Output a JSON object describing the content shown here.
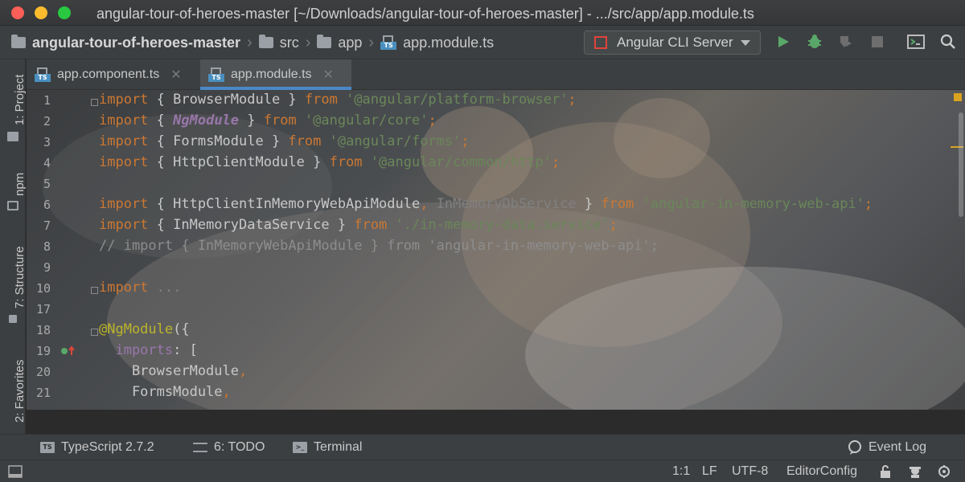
{
  "window": {
    "title": "angular-tour-of-heroes-master [~/Downloads/angular-tour-of-heroes-master] - .../src/app/app.module.ts"
  },
  "navbar": {
    "crumbs": [
      "angular-tour-of-heroes-master",
      "src",
      "app",
      "app.module.ts"
    ],
    "run_config": "Angular CLI Server",
    "icons": [
      "run-icon",
      "debug-icon",
      "coverage-icon",
      "stop-icon",
      "terminal-icon",
      "search-icon"
    ]
  },
  "left_tools": [
    "1: Project",
    "npm",
    "7: Structure",
    "2: Favorites"
  ],
  "tabs": [
    {
      "label": "app.component.ts",
      "active": false
    },
    {
      "label": "app.module.ts",
      "active": true
    }
  ],
  "editor": {
    "line_numbers": [
      "1",
      "2",
      "3",
      "4",
      "5",
      "6",
      "7",
      "8",
      "9",
      "10",
      "17",
      "18",
      "19",
      "20",
      "21"
    ],
    "lines": [
      [
        {
          "t": "import",
          "c": "kw"
        },
        {
          "t": " { BrowserModule } ",
          "c": "cls"
        },
        {
          "t": "from",
          "c": "kw"
        },
        {
          "t": " '@angular/platform-browser'",
          "c": "str"
        },
        {
          "t": ";",
          "c": "kw"
        }
      ],
      [
        {
          "t": "import",
          "c": "kw"
        },
        {
          "t": " { ",
          "c": "cls"
        },
        {
          "t": "NgModule",
          "c": "ital"
        },
        {
          "t": " } ",
          "c": "cls"
        },
        {
          "t": "from",
          "c": "kw"
        },
        {
          "t": " '@angular/core'",
          "c": "str"
        },
        {
          "t": ";",
          "c": "kw"
        }
      ],
      [
        {
          "t": "import",
          "c": "kw"
        },
        {
          "t": " { FormsModule } ",
          "c": "cls"
        },
        {
          "t": "from",
          "c": "kw"
        },
        {
          "t": " '@angular/forms'",
          "c": "str"
        },
        {
          "t": ";",
          "c": "kw"
        }
      ],
      [
        {
          "t": "import",
          "c": "kw"
        },
        {
          "t": " { HttpClientModule } ",
          "c": "cls"
        },
        {
          "t": "from",
          "c": "kw"
        },
        {
          "t": " '@angular/common/http'",
          "c": "str"
        },
        {
          "t": ";",
          "c": "kw"
        }
      ],
      [],
      [
        {
          "t": "import",
          "c": "kw"
        },
        {
          "t": " { HttpClientInMemoryWebApiModule",
          "c": "cls"
        },
        {
          "t": ",",
          "c": "kw"
        },
        {
          "t": " InMemoryDbService",
          "c": "dim"
        },
        {
          "t": " } ",
          "c": "cls"
        },
        {
          "t": "from",
          "c": "kw"
        },
        {
          "t": " 'angular-in-memory-web-api'",
          "c": "str"
        },
        {
          "t": ";",
          "c": "kw"
        }
      ],
      [
        {
          "t": "import",
          "c": "kw"
        },
        {
          "t": " { InMemoryDataService } ",
          "c": "cls"
        },
        {
          "t": "from",
          "c": "kw"
        },
        {
          "t": " './in-memory-data.service'",
          "c": "str"
        },
        {
          "t": ";",
          "c": "kw"
        }
      ],
      [
        {
          "t": "// import { InMemoryWebApiModule } from 'angular-in-memory-web-api';",
          "c": "cmt"
        }
      ],
      [],
      [
        {
          "t": "import",
          "c": "kw"
        },
        {
          "t": " ...",
          "c": "dim"
        }
      ],
      [],
      [
        {
          "t": "@NgModule",
          "c": "deco"
        },
        {
          "t": "({",
          "c": "cls"
        }
      ],
      [
        {
          "t": "  imports",
          "c": "prop"
        },
        {
          "t": ": [",
          "c": "cls"
        }
      ],
      [
        {
          "t": "    BrowserModule",
          "c": "cls"
        },
        {
          "t": ",",
          "c": "kw"
        }
      ],
      [
        {
          "t": "    FormsModule",
          "c": "cls"
        },
        {
          "t": ",",
          "c": "kw"
        }
      ]
    ]
  },
  "bottom_tools": [
    {
      "label": "TypeScript 2.7.2",
      "icon": "typescript-icon"
    },
    {
      "label": "6: TODO",
      "icon": "todo-icon"
    },
    {
      "label": "Terminal",
      "icon": "terminal-icon"
    },
    {
      "label": "Event Log",
      "icon": "event-log-icon"
    }
  ],
  "status": {
    "position": "1:1",
    "line_sep": "LF",
    "encoding": "UTF-8",
    "editor_config": "EditorConfig"
  }
}
